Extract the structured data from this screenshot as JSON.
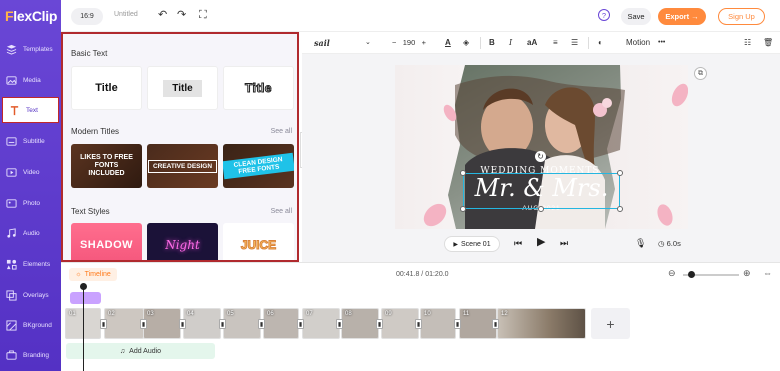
{
  "app": {
    "logo_prefix": "F",
    "logo_rest": "lexClip"
  },
  "rail": {
    "items": [
      {
        "label": "Templates",
        "icon": "templates-icon"
      },
      {
        "label": "Media",
        "icon": "media-icon"
      },
      {
        "label": "Text",
        "icon": "text-icon",
        "active": true
      },
      {
        "label": "Subtitle",
        "icon": "subtitle-icon"
      },
      {
        "label": "Video",
        "icon": "video-icon"
      },
      {
        "label": "Photo",
        "icon": "photo-icon"
      },
      {
        "label": "Audio",
        "icon": "audio-icon"
      },
      {
        "label": "Elements",
        "icon": "elements-icon"
      },
      {
        "label": "Overlays",
        "icon": "overlays-icon"
      },
      {
        "label": "BKground",
        "icon": "background-icon"
      },
      {
        "label": "Branding",
        "icon": "branding-icon"
      }
    ]
  },
  "topbar": {
    "ratio": "16:9",
    "project_name": "Untitled",
    "save": "Save",
    "export": "Export →",
    "signup": "Sign Up",
    "help": "?"
  },
  "panel": {
    "basic_title": "Basic Text",
    "basic_cards": [
      "Title",
      "Title",
      "Title"
    ],
    "modern_title": "Modern Titles",
    "modern_see_all": "See all",
    "modern_cards": [
      "LIKES TO FREE FONTS INCLUDED",
      "CREATIVE DESIGN",
      "CLEAN DESIGN FREE FONTS"
    ],
    "styles_title": "Text Styles",
    "styles_see_all": "See all",
    "style_cards": [
      "SHADOW",
      "Night",
      "JUICE"
    ]
  },
  "toolbar": {
    "font": "sail",
    "font_size": "190",
    "motion": "Motion",
    "minus": "−",
    "plus": "+",
    "more": "•••"
  },
  "canvas": {
    "line1": "WEDDING MOMENTS",
    "line2": "Mr. & Mrs.",
    "line3": "AUG 2021"
  },
  "player": {
    "scene": "Scene 01",
    "duration": "6.0s"
  },
  "timeline": {
    "label": "Timeline",
    "time": "00:41.8 / 01:20.0",
    "scenes": [
      "01",
      "02",
      "03",
      "04",
      "05",
      "06",
      "07",
      "08",
      "09",
      "10",
      "11",
      "12"
    ],
    "add_audio": "Add Audio"
  },
  "colors": {
    "brand": "#5431c4",
    "accent": "#ff8a3d",
    "selection": "#b02a2e"
  }
}
